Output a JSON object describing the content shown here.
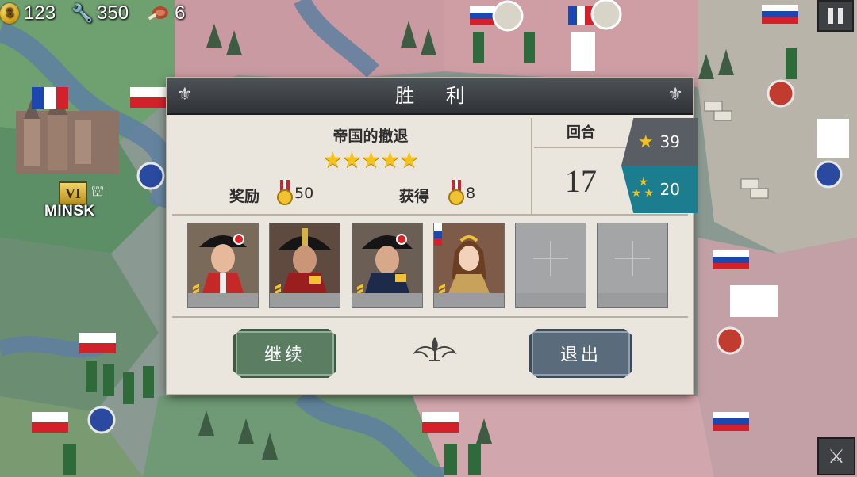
{
  "hud": {
    "gold": "123",
    "industry": "350",
    "food": "6",
    "icons": [
      "coin-icon",
      "wrench-icon",
      "meat-icon"
    ]
  },
  "map": {
    "city_name": "MINSK",
    "city_rank": "VI"
  },
  "dialog": {
    "title": "胜 利",
    "mission_name": "帝国的撤退",
    "mission_stars": "★★★★★",
    "reward_label": "奖励",
    "reward_value": "50",
    "earned_label": "获得",
    "earned_value": "8",
    "round_label": "回合",
    "round_value": "17",
    "score_stars": "39",
    "score_generals": "20",
    "slots": [
      {
        "type": "general",
        "name": "general-portrait-1"
      },
      {
        "type": "general",
        "name": "general-portrait-2"
      },
      {
        "type": "general",
        "name": "general-portrait-3"
      },
      {
        "type": "general",
        "name": "general-portrait-4"
      },
      {
        "type": "empty"
      },
      {
        "type": "empty"
      }
    ],
    "continue_label": "继续",
    "exit_label": "退出"
  },
  "colors": {
    "dialog_bg": "#ebe6dd",
    "header_bg": "#3a3e42",
    "continue_btn": "#5b7d62",
    "exit_btn": "#5a6b7b",
    "score_teal": "#1b7d8d",
    "star_gold": "#f4c21a"
  }
}
